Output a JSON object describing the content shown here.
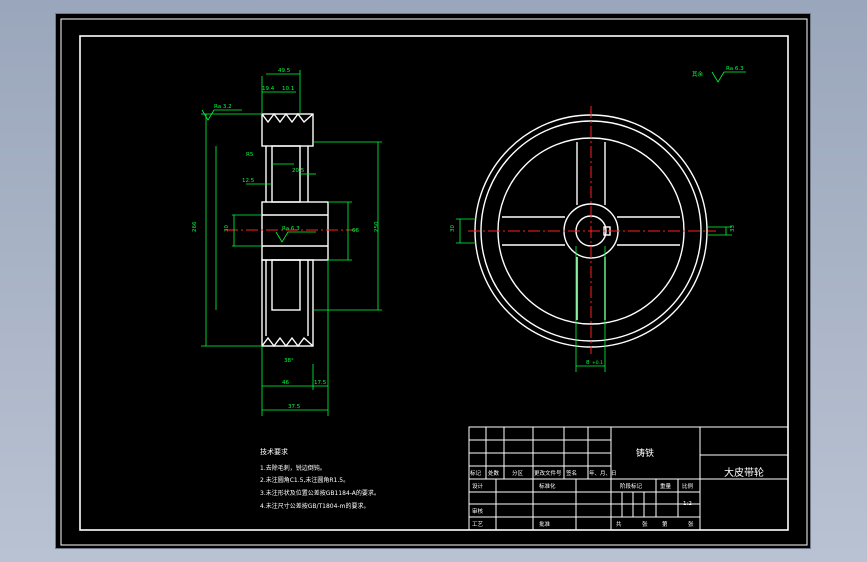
{
  "colors": {
    "background": "#000000",
    "outline": "#ffffff",
    "dimension": "#00ff00",
    "centerline": "#ff2020",
    "chrome": "#a9b3c5"
  },
  "side_view": {
    "roughness_top": "Ra 3.2",
    "roughness_bore": "Ra 6.3",
    "dim_groove_width": "49.5",
    "dim_groove_pitch": "19.4",
    "dim_groove_edge": "10.1",
    "dim_rim_depth": "R5",
    "dim_web_width": "20.5",
    "dim_web_offset": "12.5",
    "dim_hub_dia": "66",
    "dim_overall_dia": "266",
    "dim_rim_inner_dia": "250",
    "dim_bore_dia": "30",
    "dim_bore_depth": "4",
    "dim_groove_angle": "38°",
    "dim_rim_bottom": "46",
    "dim_hub_ext": "17.5",
    "dim_total_width": "37.5"
  },
  "front_view": {
    "roughness_rest_prefix": "其余",
    "roughness_rest": "Ra 6.3",
    "dim_key_left": "30",
    "dim_key_right": "33",
    "dim_key_width": "8",
    "dim_key_tol": "+0.1"
  },
  "tech_req": {
    "title": "技术要求",
    "items": [
      "1.去除毛刺，锐边倒钝。",
      "2.未注圆角C1.5,未注圆角R1.5。",
      "3.未注形状及位置公差按GB1184-A的要求。",
      "4.未注尺寸公差按GB/T1804-m的要求。"
    ]
  },
  "title_block": {
    "material": "铸铁",
    "part_name": "大皮带轮",
    "rev_labels": [
      "标记",
      "处数",
      "分区",
      "更改文件号",
      "签名",
      "年、月、日"
    ],
    "design": "设计",
    "standardize": "标准化",
    "check": "审核",
    "process": "工艺",
    "approve": "批准",
    "stage_mark": "阶段标记",
    "weight": "重量",
    "scale_label": "比例",
    "scale_value": "1:2",
    "sheet_total": "共",
    "sheet_word": "张",
    "sheet_no": "第",
    "sheet_word2": "张"
  }
}
